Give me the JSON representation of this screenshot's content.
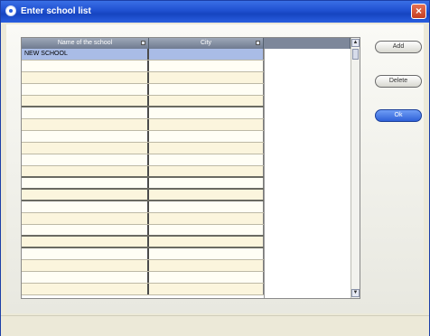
{
  "window": {
    "title": "Enter school list",
    "close_glyph": "×"
  },
  "grid": {
    "columns": [
      "Name of the school",
      "City",
      ""
    ],
    "rows": [
      {
        "name": "NEW SCHOOL",
        "city": "",
        "selected": true
      },
      {
        "name": "",
        "city": ""
      },
      {
        "name": "",
        "city": ""
      },
      {
        "name": "",
        "city": ""
      },
      {
        "name": "",
        "city": ""
      },
      {
        "name": "",
        "city": ""
      },
      {
        "name": "",
        "city": ""
      },
      {
        "name": "",
        "city": ""
      },
      {
        "name": "",
        "city": ""
      },
      {
        "name": "",
        "city": ""
      },
      {
        "name": "",
        "city": ""
      },
      {
        "name": "",
        "city": ""
      },
      {
        "name": "",
        "city": ""
      },
      {
        "name": "",
        "city": ""
      },
      {
        "name": "",
        "city": ""
      },
      {
        "name": "",
        "city": ""
      },
      {
        "name": "",
        "city": ""
      },
      {
        "name": "",
        "city": ""
      },
      {
        "name": "",
        "city": ""
      },
      {
        "name": "",
        "city": ""
      },
      {
        "name": "",
        "city": ""
      }
    ],
    "scroll_up": "▲",
    "scroll_down": "▼"
  },
  "buttons": {
    "add": "Add",
    "delete": "Delete",
    "ok": "Ok"
  },
  "icons": {
    "title": "app-icon",
    "close": "close-icon",
    "sort": "sort-icon"
  },
  "colors": {
    "titlebar": "#1f50d0",
    "row": "#fbf5dd",
    "selected": "#a9bce6",
    "ok": "#2f62d8"
  }
}
